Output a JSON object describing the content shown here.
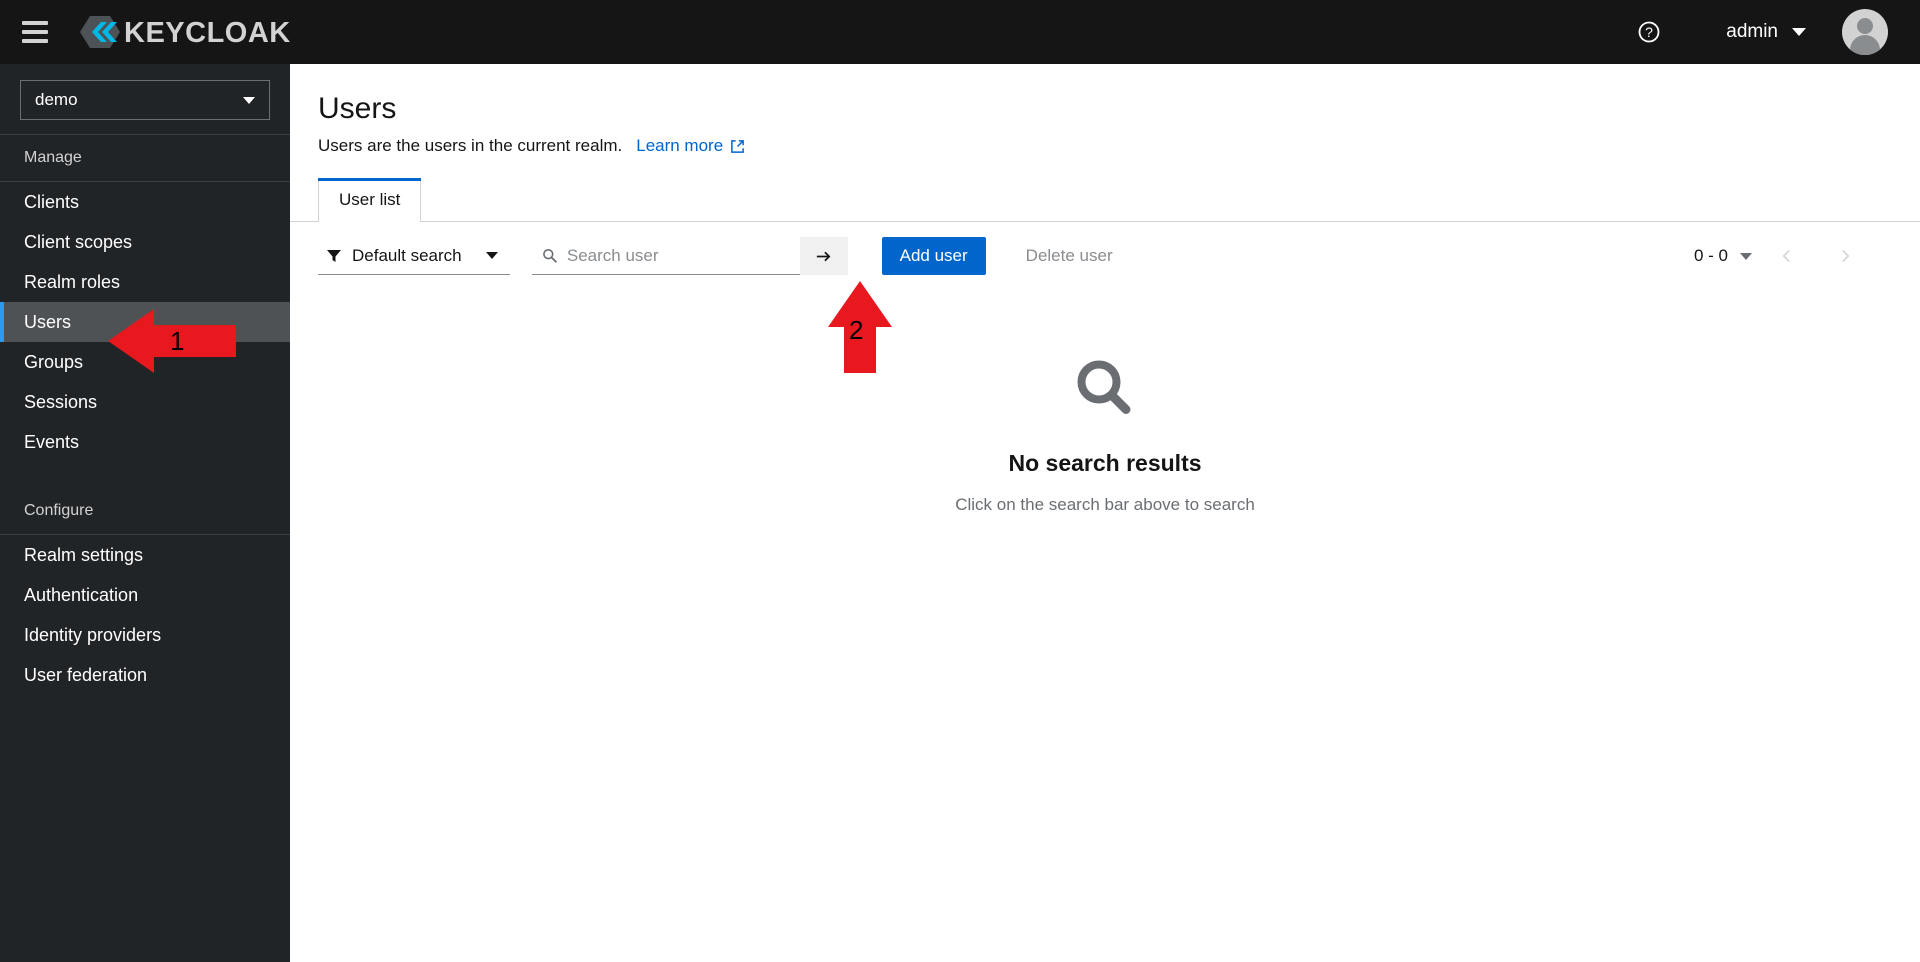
{
  "masthead": {
    "menu_icon": "hamburger-icon",
    "brand_name": "KEYCLOAK",
    "help_icon": "help-circle-icon",
    "user_name": "admin",
    "avatar_icon": "user-avatar-icon"
  },
  "sidebar": {
    "realm_selector": {
      "value": "demo",
      "caret_icon": "chevron-down-icon"
    },
    "sections": [
      {
        "title": "Manage",
        "items": [
          {
            "label": "Clients",
            "active": false
          },
          {
            "label": "Client scopes",
            "active": false
          },
          {
            "label": "Realm roles",
            "active": false
          },
          {
            "label": "Users",
            "active": true
          },
          {
            "label": "Groups",
            "active": false
          },
          {
            "label": "Sessions",
            "active": false
          },
          {
            "label": "Events",
            "active": false
          }
        ]
      },
      {
        "title": "Configure",
        "items": [
          {
            "label": "Realm settings",
            "active": false
          },
          {
            "label": "Authentication",
            "active": false
          },
          {
            "label": "Identity providers",
            "active": false
          },
          {
            "label": "User federation",
            "active": false
          }
        ]
      }
    ]
  },
  "page": {
    "title": "Users",
    "subtitle": "Users are the users in the current realm.",
    "learn_more_label": "Learn more",
    "learn_more_icon": "external-link-icon"
  },
  "tabs": [
    {
      "label": "User list",
      "active": true
    }
  ],
  "toolbar": {
    "filter": {
      "icon": "filter-funnel-icon",
      "label": "Default search",
      "caret_icon": "chevron-down-icon"
    },
    "search": {
      "icon": "search-icon",
      "value": "",
      "placeholder": "Search user",
      "submit_icon": "arrow-right-icon"
    },
    "add_user_label": "Add user",
    "delete_user_label": "Delete user",
    "pagination": {
      "range": "0 - 0",
      "caret_icon": "chevron-down-icon",
      "prev_icon": "chevron-left-icon",
      "next_icon": "chevron-right-icon"
    }
  },
  "empty_state": {
    "icon": "search-icon",
    "title": "No search results",
    "body": "Click on the search bar above to search"
  },
  "annotations": [
    {
      "number": "1",
      "direction": "left",
      "target": "sidebar-item-users"
    },
    {
      "number": "2",
      "direction": "up",
      "target": "add-user-button"
    }
  ],
  "colors": {
    "masthead_bg": "#151515",
    "sidebar_bg": "#212427",
    "accent_blue": "#0066cc",
    "nav_active_bg": "#4f5255",
    "nav_active_border": "#2b9af3",
    "annotation_red": "#e8181f"
  }
}
